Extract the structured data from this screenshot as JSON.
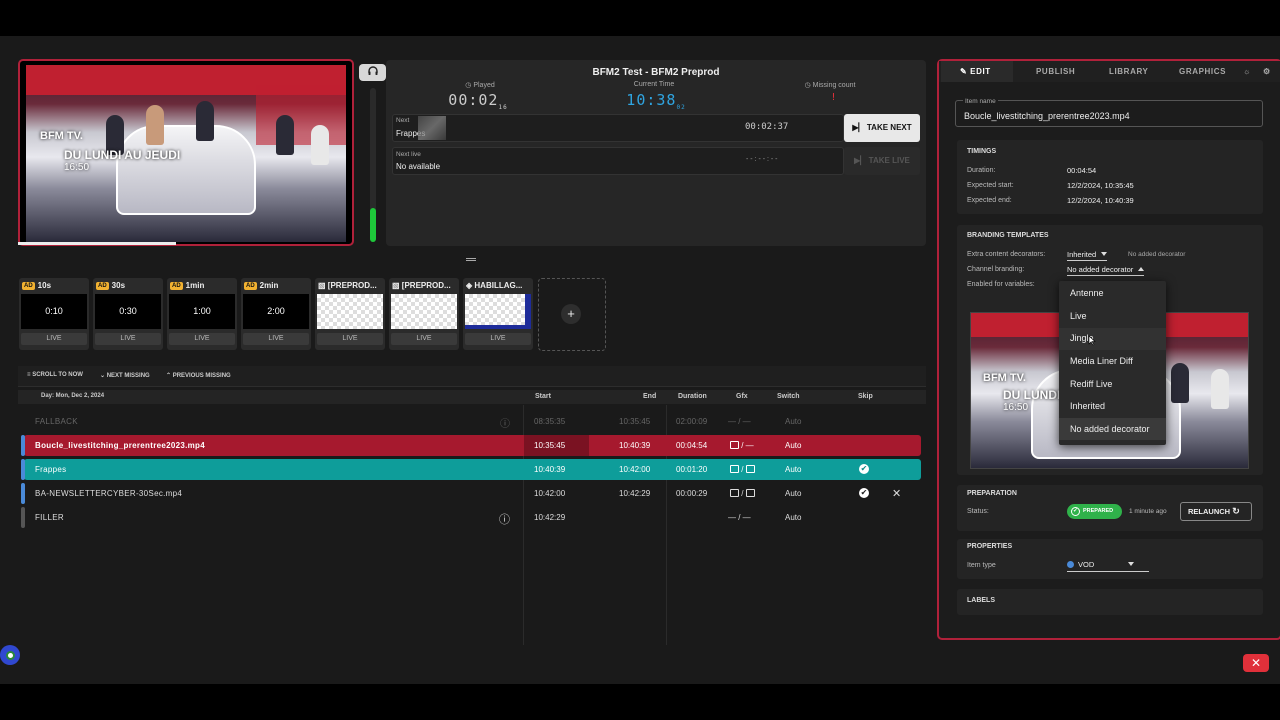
{
  "preview": {
    "logo": "BFM TV.",
    "lower_third": "DU LUNDI AU JEUDI",
    "time": "16:50"
  },
  "header": {
    "title": "BFM2 Test - BFM2 Preprod",
    "played_label": "Played",
    "played_value": "00:02",
    "played_frames": "16",
    "current_time_label": "Current Time",
    "current_time_value": "10:38",
    "current_time_frames": "02",
    "missing_label": "Missing count",
    "missing_value": "!"
  },
  "next": {
    "label": "Next",
    "name": "Frappes",
    "countdown": "00:02:37",
    "button": "TAKE NEXT"
  },
  "next_live": {
    "label": "Next live",
    "name": "No available",
    "countdown": "- - : - - : - -",
    "button": "TAKE LIVE"
  },
  "tiles": [
    {
      "badge": "AD",
      "title": "10s",
      "body": "0:10",
      "live": "LIVE"
    },
    {
      "badge": "AD",
      "title": "30s",
      "body": "0:30",
      "live": "LIVE"
    },
    {
      "badge": "AD",
      "title": "1min",
      "body": "1:00",
      "live": "LIVE"
    },
    {
      "badge": "AD",
      "title": "2min",
      "body": "2:00",
      "live": "LIVE"
    },
    {
      "badge": "",
      "title": "[PREPROD...",
      "body": "",
      "live": "LIVE"
    },
    {
      "badge": "",
      "title": "[PREPROD...",
      "body": "",
      "live": "LIVE"
    },
    {
      "badge": "",
      "title": "HABILLAG...",
      "body": "",
      "live": "LIVE"
    }
  ],
  "add_tile_icon": "+",
  "toolbar": {
    "scroll_to_now": "SCROLL TO NOW",
    "next_missing": "NEXT MISSING",
    "previous_missing": "PREVIOUS MISSING"
  },
  "playlist": {
    "day": "Day: Mon, Dec 2, 2024",
    "columns": {
      "start": "Start",
      "end": "End",
      "duration": "Duration",
      "gfx": "Gfx",
      "switch": "Switch",
      "skip": "Skip"
    },
    "rows": [
      {
        "name": "FALLBACK",
        "start": "08:35:35",
        "end": "10:35:45",
        "duration": "02:00:09",
        "gfx": "— / —",
        "switch": "Auto",
        "skip": ""
      },
      {
        "name": "Boucle_livestitching_prerentree2023.mp4",
        "start": "10:35:45",
        "end": "10:40:39",
        "duration": "00:04:54",
        "gfx": "/ —",
        "switch": "Auto",
        "skip": ""
      },
      {
        "name": "Frappes",
        "start": "10:40:39",
        "end": "10:42:00",
        "duration": "00:01:20",
        "gfx": "/",
        "switch": "Auto",
        "skip": "✔"
      },
      {
        "name": "BA-NEWSLETTERCYBER-30Sec.mp4",
        "start": "10:42:00",
        "end": "10:42:29",
        "duration": "00:00:29",
        "gfx": "/",
        "switch": "Auto",
        "skip": "✔"
      },
      {
        "name": "FILLER",
        "start": "10:42:29",
        "end": "",
        "duration": "",
        "gfx": "— / —",
        "switch": "Auto",
        "skip": ""
      }
    ]
  },
  "right_panel": {
    "tabs": [
      "EDIT",
      "PUBLISH",
      "LIBRARY",
      "GRAPHICS"
    ],
    "item_name_label": "Item name",
    "item_name_value": "Boucle_livestitching_prerentree2023.mp4",
    "timings": {
      "title": "TIMINGS",
      "duration_label": "Duration:",
      "duration_value": "00:04:54",
      "start_label": "Expected start:",
      "start_value": "12/2/2024, 10:35:45",
      "end_label": "Expected end:",
      "end_value": "12/2/2024, 10:40:39"
    },
    "branding": {
      "title": "BRANDING TEMPLATES",
      "extra_label": "Extra content decorators:",
      "extra_value": "Inherited",
      "extra_note": "No added decorator",
      "channel_label": "Channel branding:",
      "channel_value": "No added decorator",
      "variables_label": "Enabled for variables:"
    },
    "dropdown_options": [
      "Antenne",
      "Live",
      "Jingle",
      "Media Liner Diff",
      "Rediff Live",
      "Inherited",
      "No added decorator"
    ],
    "preparation": {
      "title": "PREPARATION",
      "status_label": "Status:",
      "status_value": "PREPARED",
      "status_time": "1 minute ago",
      "relaunch": "RELAUNCH"
    },
    "properties": {
      "title": "PROPERTIES",
      "item_type_label": "Item type",
      "item_type_value": "VOD"
    },
    "labels_title": "LABELS"
  },
  "colors": {
    "accent_red": "#b0213a",
    "teal": "#0e9d9a",
    "red_row": "#a6192e",
    "prepared_green": "#2fb24a"
  }
}
